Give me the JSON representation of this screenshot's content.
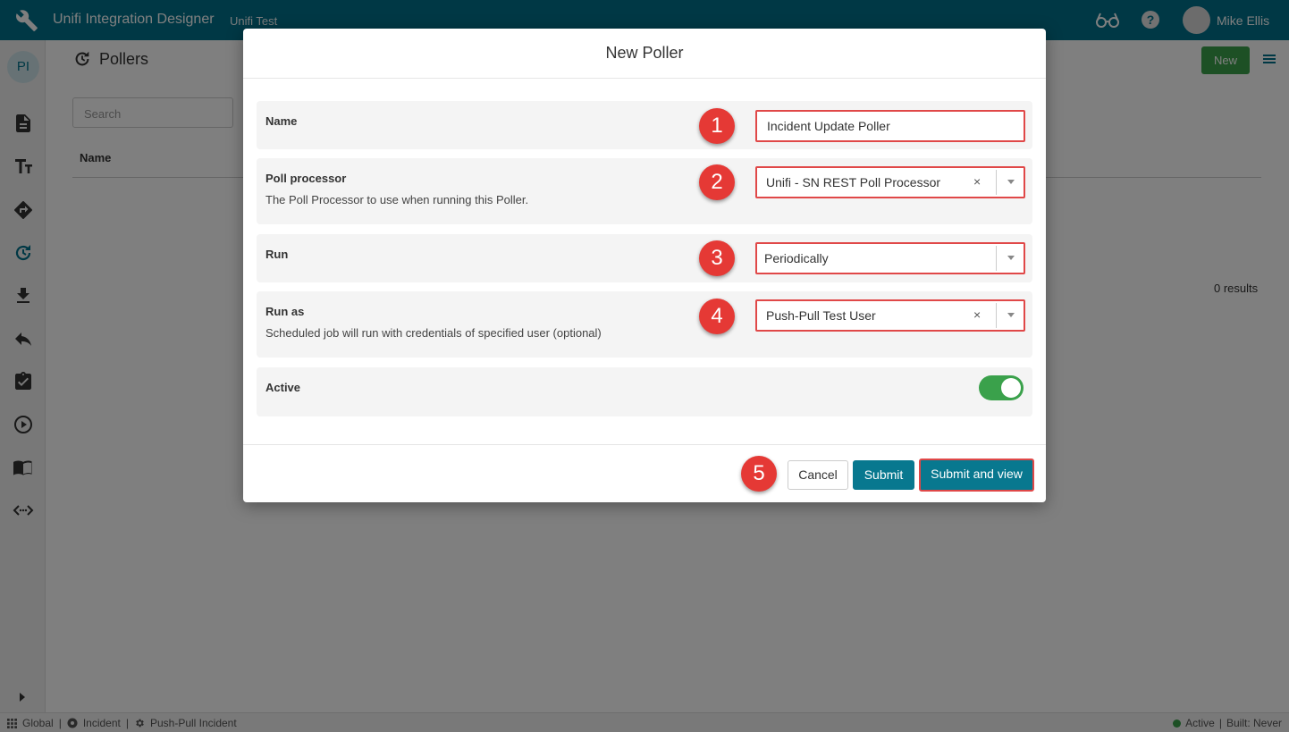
{
  "app": {
    "title": "Unifi Integration Designer",
    "subtitle": "Unifi Test",
    "user_name": "Mike Ellis",
    "help_glyph": "?",
    "badge": "PI"
  },
  "page": {
    "title": "Pollers",
    "new_label": "New",
    "search_placeholder": "Search",
    "column_name": "Name",
    "results": "0 results"
  },
  "statusbar": {
    "global": "Global",
    "incident": "Incident",
    "integration": "Push-Pull Incident",
    "active": "Active",
    "built": "Built: Never",
    "separator": "|"
  },
  "modal": {
    "title": "New Poller",
    "fields": {
      "name": {
        "label": "Name",
        "value": "Incident Update Poller"
      },
      "poll_processor": {
        "label": "Poll processor",
        "description": "The Poll Processor to use when running this Poller.",
        "value": "Unifi - SN REST Poll Processor",
        "clear": "×"
      },
      "run": {
        "label": "Run",
        "value": "Periodically"
      },
      "run_as": {
        "label": "Run as",
        "description": "Scheduled job will run with credentials of specified user (optional)",
        "value": "Push-Pull Test User",
        "clear": "×"
      },
      "active": {
        "label": "Active",
        "on": true
      }
    },
    "buttons": {
      "cancel": "Cancel",
      "submit": "Submit",
      "submit_view": "Submit and view"
    },
    "steps": [
      "1",
      "2",
      "3",
      "4",
      "5"
    ]
  },
  "colors": {
    "topbar": "#01718a",
    "primary_button": "#08788f",
    "new_button": "#3aa14b",
    "highlight": "#e04848",
    "step_badge": "#e53935"
  }
}
